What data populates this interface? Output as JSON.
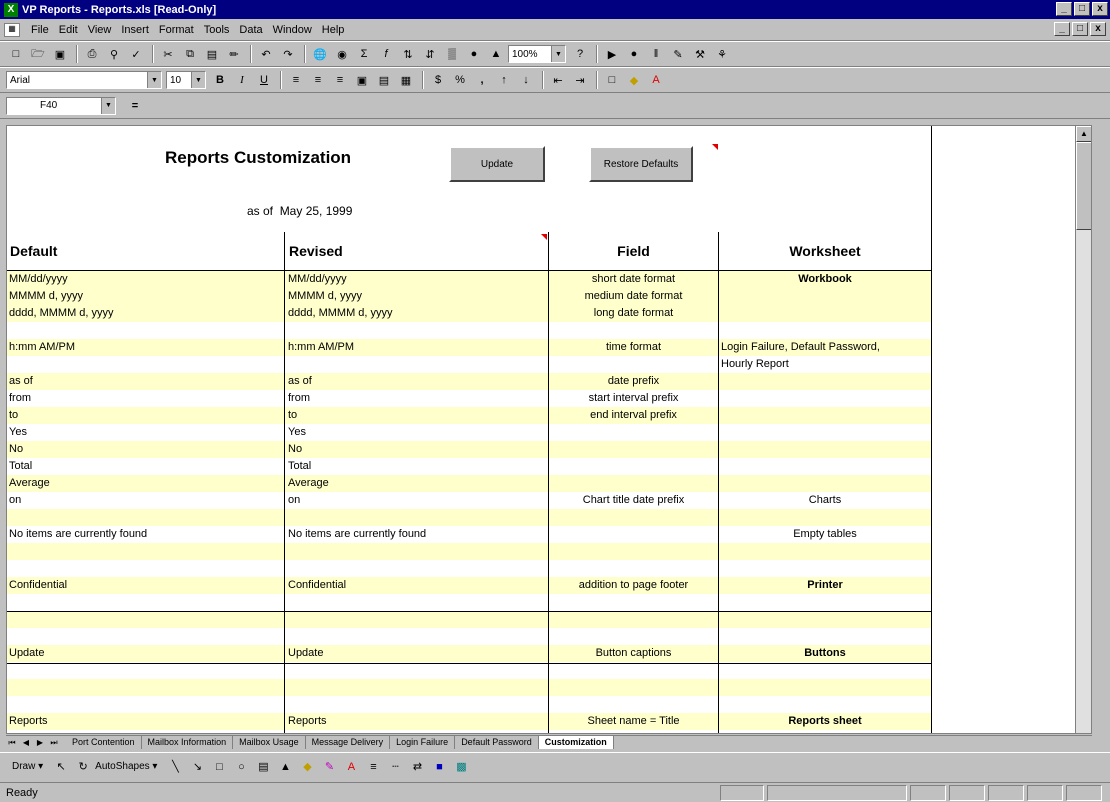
{
  "window": {
    "title": "VP Reports - Reports.xls  [Read-Only]",
    "app_icon": "excel-icon",
    "controls": [
      "_",
      "□",
      "x"
    ]
  },
  "menubar": {
    "items": [
      "File",
      "Edit",
      "View",
      "Insert",
      "Format",
      "Tools",
      "Data",
      "Window",
      "Help"
    ]
  },
  "toolbar_standard": {
    "zoom": "100%"
  },
  "toolbar_formatting": {
    "font": "Arial",
    "size": "10",
    "bold": "B",
    "italic": "I",
    "underline": "U",
    "currency": "$",
    "percent": "%",
    "comma": ","
  },
  "formula_bar": {
    "namebox": "F40",
    "equals": "="
  },
  "sheet": {
    "heading": "Reports Customization",
    "update_button": "Update",
    "restore_button": "Restore Defaults",
    "asof_label": "as of",
    "asof_date": "May 25, 1999",
    "col_headers": [
      "Default",
      "Revised",
      "Field",
      "Worksheet"
    ],
    "rows": [
      {
        "d": "MM/dd/yyyy",
        "r": "MM/dd/yyyy",
        "f": "short date format",
        "w": "Workbook",
        "wb": true,
        "y": true
      },
      {
        "d": "MMMM d, yyyy",
        "r": "MMMM d, yyyy",
        "f": "medium date format",
        "w": "",
        "y": true
      },
      {
        "d": "dddd, MMMM d, yyyy",
        "r": "dddd, MMMM d, yyyy",
        "f": "long date format",
        "w": "",
        "y": true
      },
      {
        "d": "",
        "r": "",
        "f": "",
        "w": "",
        "y": false
      },
      {
        "d": "h:mm AM/PM",
        "r": "h:mm AM/PM",
        "f": "time format",
        "w": "Login Failure, Default Password,",
        "wl": true,
        "y": true
      },
      {
        "d": "",
        "r": "",
        "f": "",
        "w": "Hourly Report",
        "wl": true,
        "y": false
      },
      {
        "d": "as of",
        "r": "as of",
        "f": "date prefix",
        "w": "",
        "y": true
      },
      {
        "d": "from",
        "r": "from",
        "f": "start interval prefix",
        "w": "",
        "y": false
      },
      {
        "d": "to",
        "r": "to",
        "f": "end interval prefix",
        "w": "",
        "y": true
      },
      {
        "d": "Yes",
        "r": "Yes",
        "f": "",
        "w": "",
        "y": false
      },
      {
        "d": "No",
        "r": "No",
        "f": "",
        "w": "",
        "y": true
      },
      {
        "d": "Total",
        "r": "Total",
        "f": "",
        "w": "",
        "y": false
      },
      {
        "d": "Average",
        "r": "Average",
        "f": "",
        "w": "",
        "y": true
      },
      {
        "d": "on",
        "r": "on",
        "f": "Chart title date prefix",
        "w": "Charts",
        "y": false
      },
      {
        "d": "",
        "r": "",
        "f": "",
        "w": "",
        "y": true
      },
      {
        "d": "No items are currently found",
        "r": "No items are currently found",
        "f": "",
        "w": "Empty tables",
        "y": false
      },
      {
        "d": "",
        "r": "",
        "f": "",
        "w": "",
        "y": true
      },
      {
        "d": "",
        "r": "",
        "f": "",
        "w": "",
        "y": false
      },
      {
        "d": "Confidential",
        "r": "Confidential",
        "f": "addition to page footer",
        "w": "Printer",
        "wb": true,
        "y": true
      },
      {
        "d": "",
        "r": "",
        "f": "",
        "w": "",
        "y": false
      },
      {
        "d": "",
        "r": "",
        "f": "",
        "w": "",
        "y": true
      },
      {
        "d": "",
        "r": "",
        "f": "",
        "w": "",
        "y": false
      },
      {
        "d": "Update",
        "r": "Update",
        "f": "Button captions",
        "w": "Buttons",
        "wb": true,
        "y": true
      },
      {
        "d": "",
        "r": "",
        "f": "",
        "w": "",
        "y": false
      },
      {
        "d": "",
        "r": "",
        "f": "",
        "w": "",
        "y": true
      },
      {
        "d": "",
        "r": "",
        "f": "",
        "w": "",
        "y": false
      },
      {
        "d": "Reports",
        "r": "Reports",
        "f": "Sheet name = Title",
        "w": "Reports sheet",
        "wb": true,
        "y": true
      }
    ]
  },
  "tabs": {
    "sheets": [
      "Port Contention",
      "Mailbox Information",
      "Mailbox Usage",
      "Message Delivery",
      "Login Failure",
      "Default Password",
      "Customization"
    ],
    "active": "Customization"
  },
  "drawbar": {
    "draw": "Draw",
    "autoshapes": "AutoShapes"
  },
  "status": {
    "text": "Ready"
  }
}
